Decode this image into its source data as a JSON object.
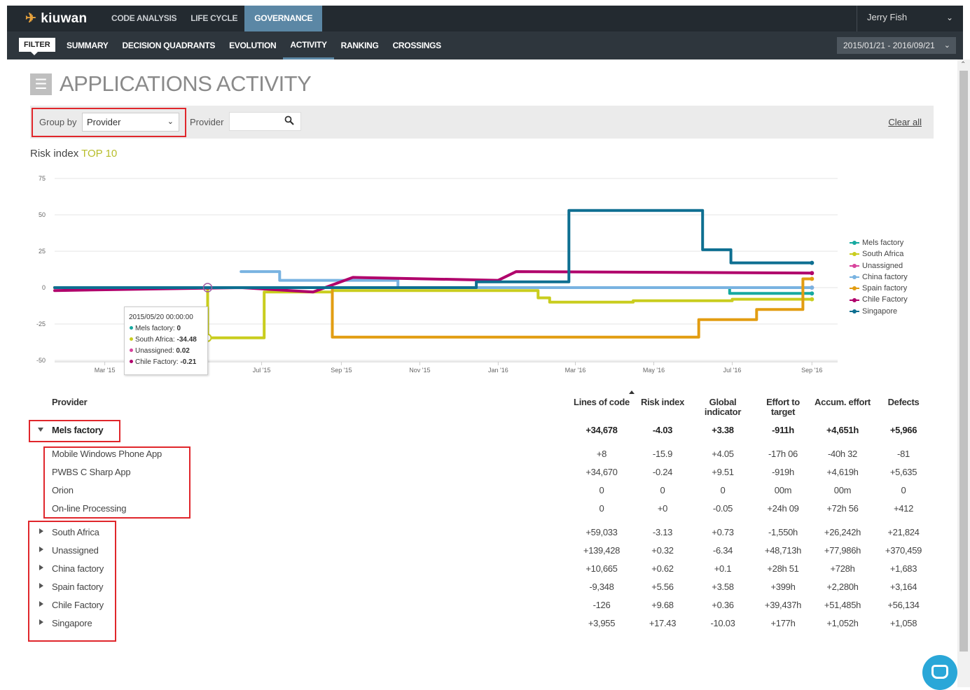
{
  "topbar": {
    "logo": "kiuwan",
    "nav": [
      "CODE ANALYSIS",
      "LIFE CYCLE",
      "GOVERNANCE"
    ],
    "active_nav": "GOVERNANCE",
    "user": "Jerry Fish"
  },
  "subbar": {
    "filter_label": "FILTER",
    "nav": [
      "SUMMARY",
      "DECISION QUADRANTS",
      "EVOLUTION",
      "ACTIVITY",
      "RANKING",
      "CROSSINGS"
    ],
    "active_nav": "ACTIVITY",
    "date_range": "2015/01/21 - 2016/09/21"
  },
  "page": {
    "title": "APPLICATIONS ACTIVITY"
  },
  "filters": {
    "group_by_label": "Group by",
    "group_by_value": "Provider",
    "provider_label": "Provider",
    "provider_value": "",
    "clear_all": "Clear all"
  },
  "chart_heading": {
    "label": "Risk index",
    "highlight": "TOP 10"
  },
  "chart_data": {
    "type": "line",
    "step": true,
    "y_ticks": [
      75,
      50,
      25,
      0,
      -25,
      -50
    ],
    "ylim": [
      -50,
      75
    ],
    "x_tick_labels": [
      "Mar '15",
      "Jul '15",
      "Sep '15",
      "Nov '15",
      "Jan '16",
      "Mar '16",
      "May '16",
      "Jul '16",
      "Sep '16"
    ],
    "x_tick_dates": [
      "2015-03-01",
      "2015-07-01",
      "2015-09-01",
      "2015-11-01",
      "2016-01-01",
      "2016-03-01",
      "2016-05-01",
      "2016-07-01",
      "2016-09-01"
    ],
    "xlim": [
      "2015-01-21",
      "2016-09-21"
    ],
    "legend_position": "right",
    "series": [
      {
        "name": "Mels factory",
        "color": "#16a9a0",
        "points": [
          [
            "2015-01-21",
            0
          ],
          [
            "2016-06-29",
            0
          ],
          [
            "2016-06-29",
            -4
          ],
          [
            "2016-09-01",
            -4
          ]
        ]
      },
      {
        "name": "South Africa",
        "color": "#c9cd1e",
        "points": [
          [
            "2015-01-21",
            0
          ],
          [
            "2015-05-20",
            0
          ],
          [
            "2015-05-20",
            -34.48
          ],
          [
            "2015-07-03",
            -34.48
          ],
          [
            "2015-07-03",
            -3
          ],
          [
            "2015-08-25",
            -3
          ],
          [
            "2015-08-25",
            -2
          ],
          [
            "2016-02-01",
            -2
          ],
          [
            "2016-02-01",
            -7
          ],
          [
            "2016-02-10",
            -7
          ],
          [
            "2016-02-10",
            -10
          ],
          [
            "2016-04-15",
            -10
          ],
          [
            "2016-04-15",
            -9
          ],
          [
            "2016-07-01",
            -9
          ],
          [
            "2016-07-01",
            -8
          ],
          [
            "2016-09-01",
            -8
          ]
        ]
      },
      {
        "name": "Unassigned",
        "color": "#d8439c",
        "points": [
          [
            "2015-01-21",
            0
          ],
          [
            "2016-09-01",
            0
          ]
        ]
      },
      {
        "name": "China factory",
        "color": "#79b3e1",
        "points": [
          [
            "2015-06-15",
            11
          ],
          [
            "2015-07-15",
            11
          ],
          [
            "2015-07-15",
            5
          ],
          [
            "2015-10-15",
            5
          ],
          [
            "2015-10-15",
            0
          ],
          [
            "2016-09-01",
            0
          ]
        ]
      },
      {
        "name": "Spain factory",
        "color": "#e29d12",
        "points": [
          [
            "2015-01-21",
            0
          ],
          [
            "2015-08-25",
            0
          ],
          [
            "2015-08-25",
            -34
          ],
          [
            "2016-06-05",
            -34
          ],
          [
            "2016-06-05",
            -22
          ],
          [
            "2016-07-20",
            -22
          ],
          [
            "2016-07-20",
            -15
          ],
          [
            "2016-08-25",
            -15
          ],
          [
            "2016-08-25",
            6
          ],
          [
            "2016-09-01",
            6
          ]
        ]
      },
      {
        "name": "Chile Factory",
        "color": "#b0006b",
        "points": [
          [
            "2015-01-21",
            -2
          ],
          [
            "2015-06-15",
            0
          ],
          [
            "2015-08-10",
            -3
          ],
          [
            "2015-09-10",
            7
          ],
          [
            "2016-01-01",
            5
          ],
          [
            "2016-01-15",
            11
          ],
          [
            "2016-09-01",
            10
          ]
        ]
      },
      {
        "name": "Singapore",
        "color": "#0e6f91",
        "points": [
          [
            "2015-01-21",
            0
          ],
          [
            "2015-12-15",
            0
          ],
          [
            "2015-12-15",
            4
          ],
          [
            "2016-02-25",
            4
          ],
          [
            "2016-02-25",
            53
          ],
          [
            "2016-06-08",
            53
          ],
          [
            "2016-06-08",
            26
          ],
          [
            "2016-06-30",
            26
          ],
          [
            "2016-06-30",
            17
          ],
          [
            "2016-09-01",
            17
          ]
        ]
      }
    ]
  },
  "tooltip": {
    "title": "2015/05/20 00:00:00",
    "items": [
      {
        "label": "Mels factory:",
        "value": "0",
        "color": "#16a9a0"
      },
      {
        "label": "South Africa:",
        "value": "-34.48",
        "color": "#c9cd1e"
      },
      {
        "label": "Unassigned:",
        "value": "0.02",
        "color": "#d8439c"
      },
      {
        "label": "Chile Factory:",
        "value": "-0.21",
        "color": "#b0006b"
      }
    ]
  },
  "table": {
    "headers": {
      "provider": "Provider",
      "loc": "Lines of code",
      "risk": "Risk index",
      "global_1": "Global",
      "global_2": "indicator",
      "effort_1": "Effort to",
      "effort_2": "target",
      "accum": "Accum. effort",
      "defects": "Defects"
    },
    "rows": [
      {
        "name": "Mels factory",
        "expanded": true,
        "bold": true,
        "values": [
          "+34,678",
          "-4.03",
          "+3.38",
          "-911h",
          "+4,651h",
          "+5,966"
        ]
      },
      {
        "name": "Mobile Windows Phone App",
        "child": true,
        "values": [
          "+8",
          "-15.9",
          "+4.05",
          "-17h 06",
          "-40h 32",
          "-81"
        ]
      },
      {
        "name": "PWBS C Sharp App",
        "child": true,
        "values": [
          "+34,670",
          "-0.24",
          "+9.51",
          "-919h",
          "+4,619h",
          "+5,635"
        ]
      },
      {
        "name": "Orion",
        "child": true,
        "values": [
          "0",
          "0",
          "0",
          "00m",
          "00m",
          "0"
        ]
      },
      {
        "name": "On-line Processing",
        "child": true,
        "values": [
          "0",
          "+0",
          "-0.05",
          "+24h 09",
          "+72h 56",
          "+412"
        ]
      },
      {
        "name": "South Africa",
        "values": [
          "+59,033",
          "-3.13",
          "+0.73",
          "-1,550h",
          "+26,242h",
          "+21,824"
        ]
      },
      {
        "name": "Unassigned",
        "values": [
          "+139,428",
          "+0.32",
          "-6.34",
          "+48,713h",
          "+77,986h",
          "+370,459"
        ]
      },
      {
        "name": "China factory",
        "values": [
          "+10,665",
          "+0.62",
          "+0.1",
          "+28h 51",
          "+728h",
          "+1,683"
        ]
      },
      {
        "name": "Spain factory",
        "values": [
          "-9,348",
          "+5.56",
          "+3.58",
          "+399h",
          "+2,280h",
          "+3,164"
        ]
      },
      {
        "name": "Chile Factory",
        "values": [
          "-126",
          "+9.68",
          "+0.36",
          "+39,437h",
          "+51,485h",
          "+56,134"
        ]
      },
      {
        "name": "Singapore",
        "values": [
          "+3,955",
          "+17.43",
          "-10.03",
          "+177h",
          "+1,052h",
          "+1,058"
        ]
      }
    ]
  }
}
